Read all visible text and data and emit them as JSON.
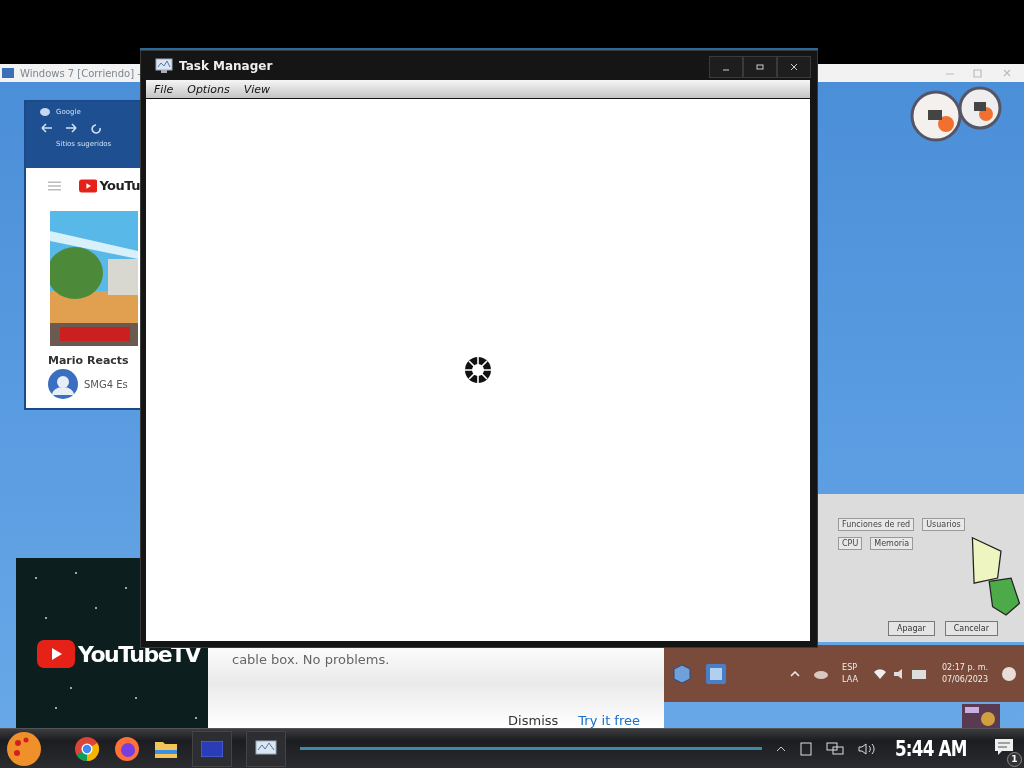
{
  "vm_window": {
    "title": "Windows 7 [Corriendo] -"
  },
  "browser_window": {
    "tab_title": "Google",
    "bookmarks": "Sitios sugeridos",
    "logo_text": "YouTu",
    "video_title": "Mario Reacts",
    "channel": "SMG4 Es"
  },
  "ad": {
    "logo_text": "YouTubeTV",
    "text": "cable box. No problems.",
    "buttons": [
      {
        "label": "Dismiss",
        "kind": "plain"
      },
      {
        "label": "Try it free",
        "kind": "link"
      }
    ]
  },
  "dialog": {
    "tabs": [
      "Funciones de red",
      "Usuarios"
    ],
    "columns": [
      "CPU",
      "Memoria"
    ],
    "buttons": [
      "Apagar",
      "Cancelar"
    ]
  },
  "vm_taskbar": {
    "language": [
      "ESP",
      "LAA"
    ],
    "time": "02:17 p. m.",
    "date": "07/06/2023"
  },
  "task_manager": {
    "title": "Task Manager",
    "menu": [
      "File",
      "Options",
      "View"
    ]
  },
  "taskbar": {
    "clock": "5:44 AM",
    "notification_count": "1"
  }
}
